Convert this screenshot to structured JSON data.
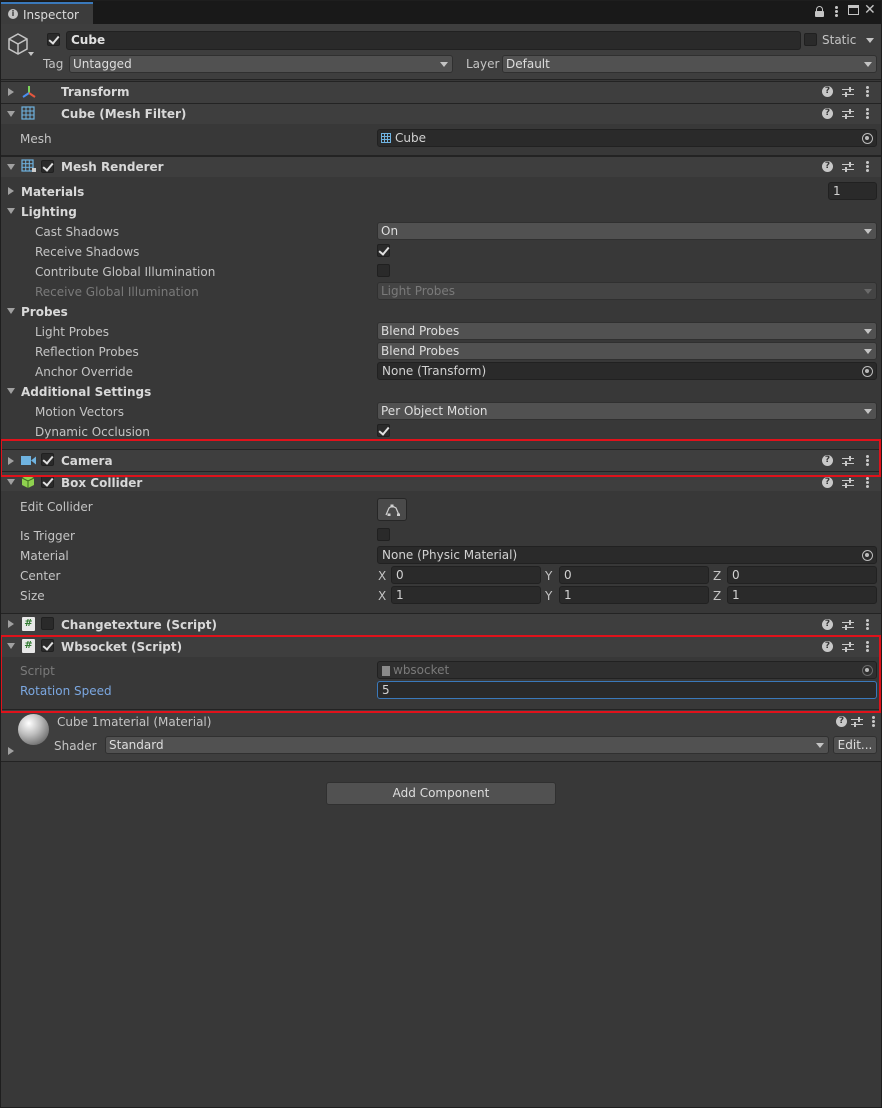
{
  "window": {
    "tab_label": "Inspector",
    "info_icon": "info-icon",
    "controls": [
      "lock-icon",
      "menu-dots-icon",
      "maximize-icon",
      "close-icon"
    ]
  },
  "object": {
    "name": "Cube",
    "active": true,
    "static_label": "Static",
    "static": false,
    "tag_label": "Tag",
    "tag_value": "Untagged",
    "layer_label": "Layer",
    "layer_value": "Default"
  },
  "transform": {
    "title": "Transform"
  },
  "mesh_filter": {
    "title": "Cube (Mesh Filter)",
    "mesh_label": "Mesh",
    "mesh_value": "Cube"
  },
  "mesh_renderer": {
    "title": "Mesh Renderer",
    "enabled": true,
    "materials_label": "Materials",
    "materials_count": "1",
    "lighting_label": "Lighting",
    "cast_shadows_label": "Cast Shadows",
    "cast_shadows_value": "On",
    "receive_shadows_label": "Receive Shadows",
    "receive_shadows": true,
    "contribute_gi_label": "Contribute Global Illumination",
    "contribute_gi": false,
    "receive_gi_label": "Receive Global Illumination",
    "receive_gi_value": "Light Probes",
    "probes_label": "Probes",
    "light_probes_label": "Light Probes",
    "light_probes_value": "Blend Probes",
    "reflection_probes_label": "Reflection Probes",
    "reflection_probes_value": "Blend Probes",
    "anchor_override_label": "Anchor Override",
    "anchor_override_value": "None (Transform)",
    "additional_label": "Additional Settings",
    "motion_vectors_label": "Motion Vectors",
    "motion_vectors_value": "Per Object Motion",
    "dynamic_occlusion_label": "Dynamic Occlusion",
    "dynamic_occlusion": true
  },
  "camera": {
    "title": "Camera",
    "enabled": true
  },
  "box_collider": {
    "title": "Box Collider",
    "enabled": true,
    "edit_collider_label": "Edit Collider",
    "is_trigger_label": "Is Trigger",
    "is_trigger": false,
    "material_label": "Material",
    "material_value": "None (Physic Material)",
    "center_label": "Center",
    "center": {
      "x": "0",
      "y": "0",
      "z": "0"
    },
    "size_label": "Size",
    "size": {
      "x": "1",
      "y": "1",
      "z": "1"
    },
    "axis_x": "X",
    "axis_y": "Y",
    "axis_z": "Z"
  },
  "changetexture": {
    "title": "Changetexture (Script)",
    "enabled": false
  },
  "wbsocket": {
    "title": "Wbsocket (Script)",
    "enabled": true,
    "script_label": "Script",
    "script_value": "wbsocket",
    "rotation_speed_label": "Rotation Speed",
    "rotation_speed_value": "5"
  },
  "material": {
    "title": "Cube 1material (Material)",
    "shader_label": "Shader",
    "shader_value": "Standard",
    "edit_label": "Edit..."
  },
  "add_component_label": "Add Component",
  "colors": {
    "background": "#383838",
    "header": "#3e3e3e",
    "highlight": "#e0121b",
    "focus_blue": "#3a79bb",
    "label_blue": "#7ba7e0"
  }
}
